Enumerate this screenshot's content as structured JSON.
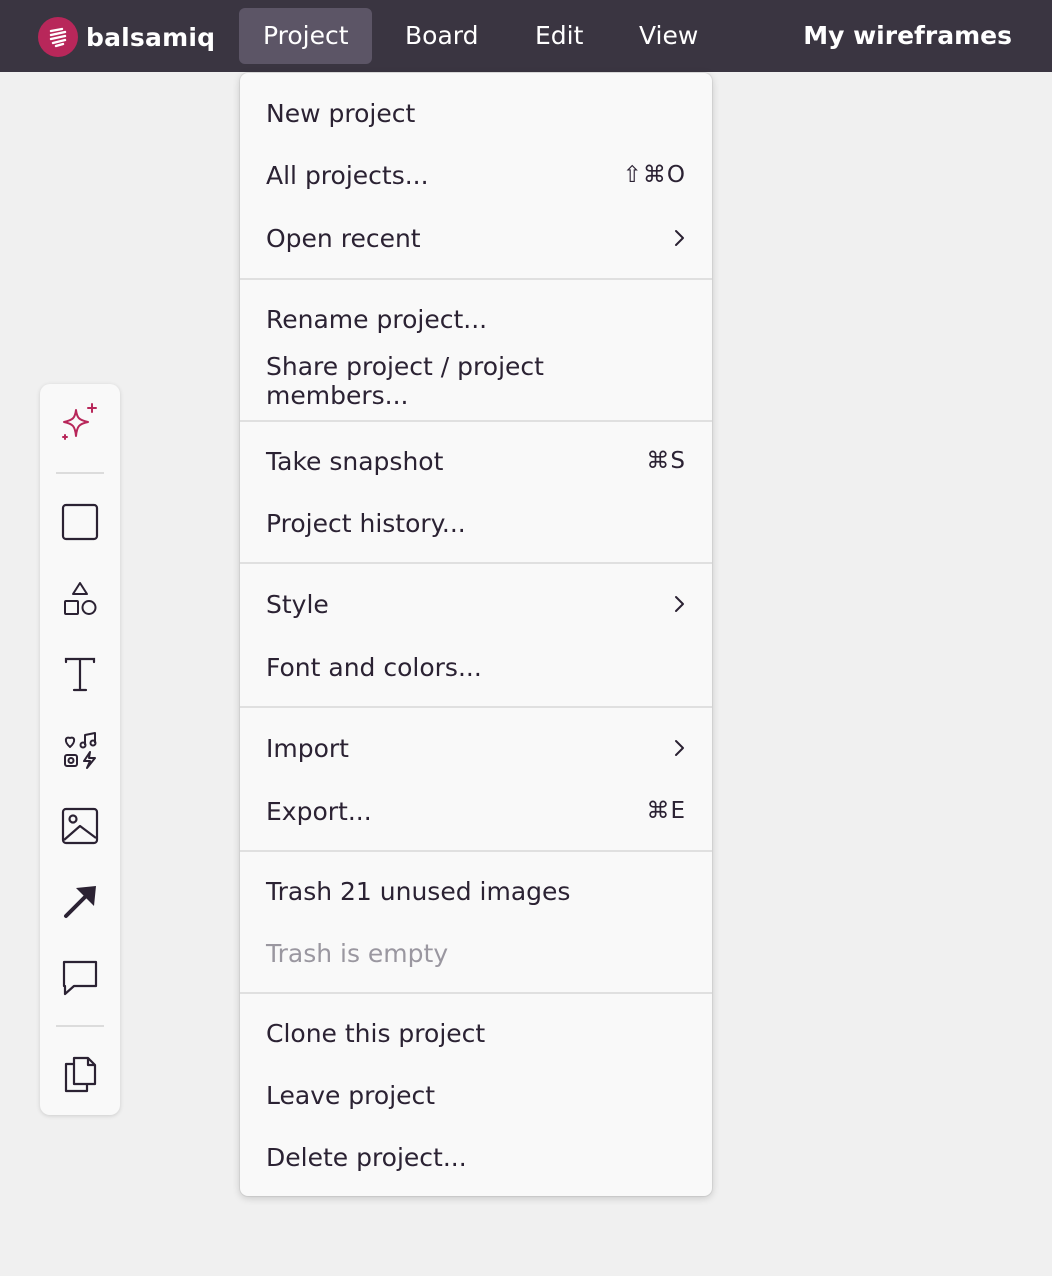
{
  "app": {
    "logo_text": "balsamiq",
    "colors": {
      "topbar": "#3a3541",
      "brand": "#b8275a",
      "accent_active": "#5c5566"
    }
  },
  "menubar": {
    "project": "Project",
    "board": "Board",
    "edit": "Edit",
    "view": "View",
    "my_wireframes": "My wireframes"
  },
  "toolbar": {
    "tools": [
      "ai-sparkle-icon",
      "rectangle-icon",
      "shapes-icon",
      "text-icon",
      "icons-library-icon",
      "image-icon",
      "arrow-icon",
      "comment-icon",
      "copy-icon"
    ]
  },
  "project_menu": {
    "new_project": "New project",
    "all_projects": "All projects...",
    "all_projects_shortcut": "⇧⌘O",
    "open_recent": "Open recent",
    "rename_project": "Rename project...",
    "share_project": "Share project / project members...",
    "take_snapshot": "Take snapshot",
    "take_snapshot_shortcut": "⌘S",
    "project_history": "Project history...",
    "style": "Style",
    "font_and_colors": "Font and colors...",
    "import": "Import",
    "export": "Export...",
    "export_shortcut": "⌘E",
    "trash_unused": "Trash 21 unused images",
    "trash_empty": "Trash is empty",
    "clone_project": "Clone this project",
    "leave_project": "Leave project",
    "delete_project": "Delete project..."
  }
}
